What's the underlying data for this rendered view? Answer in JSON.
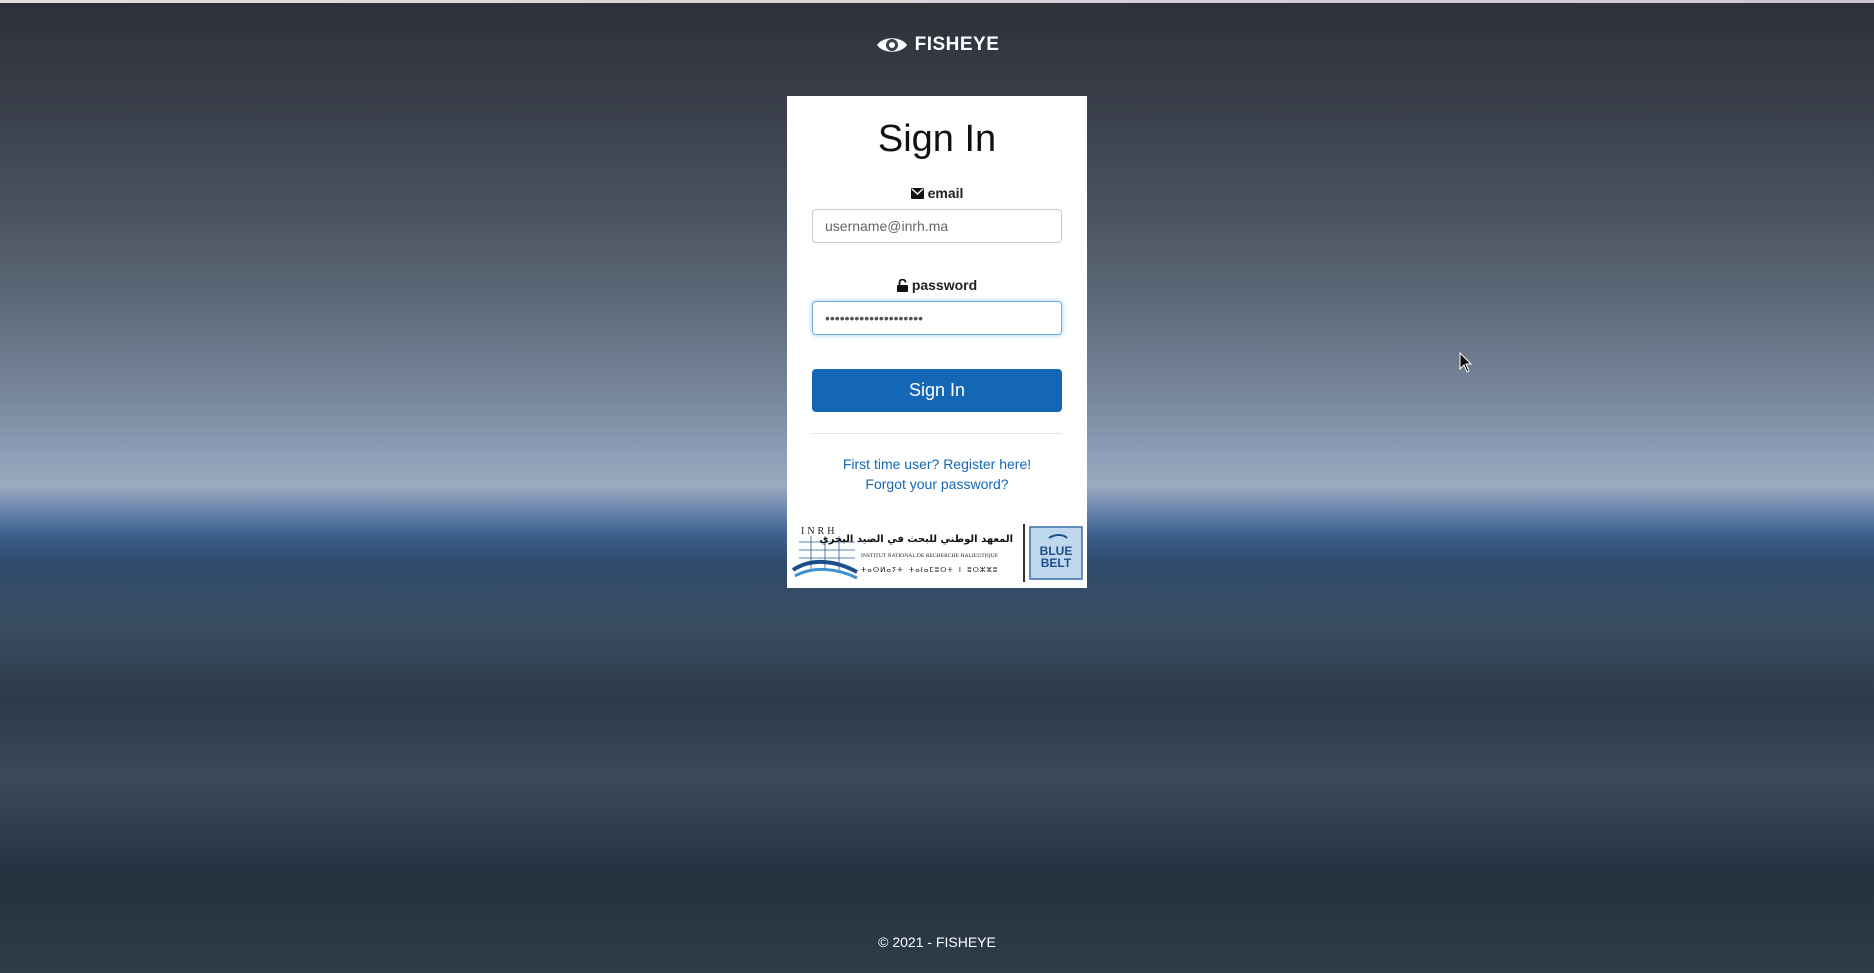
{
  "brand": {
    "name": "FISHEYE",
    "logo_icon": "eye-icon"
  },
  "signin": {
    "title": "Sign In",
    "email_label": "email",
    "email_placeholder": "username@inrh.ma",
    "email_value": "",
    "password_label": "password",
    "password_value": "••••••••••••••••••••",
    "submit_label": "Sign In",
    "register_link": "First time user? Register here!",
    "forgot_link": "Forgot your password?"
  },
  "partners": {
    "inrh_acronym": "INRH",
    "inrh_arabic": "المعهد الوطني للبحث في الصيد البحري",
    "inrh_french": "INSTITUT NATIONAL DE RECHERCHE HALIEUTIQUE",
    "bluebelt_line1": "BLUE",
    "bluebelt_line2": "BELT"
  },
  "footer": {
    "text": "© 2021 - FISHEYE"
  },
  "colors": {
    "accent": "#1467b4",
    "card_bg": "#ffffff",
    "focus_border": "#66afe9"
  }
}
